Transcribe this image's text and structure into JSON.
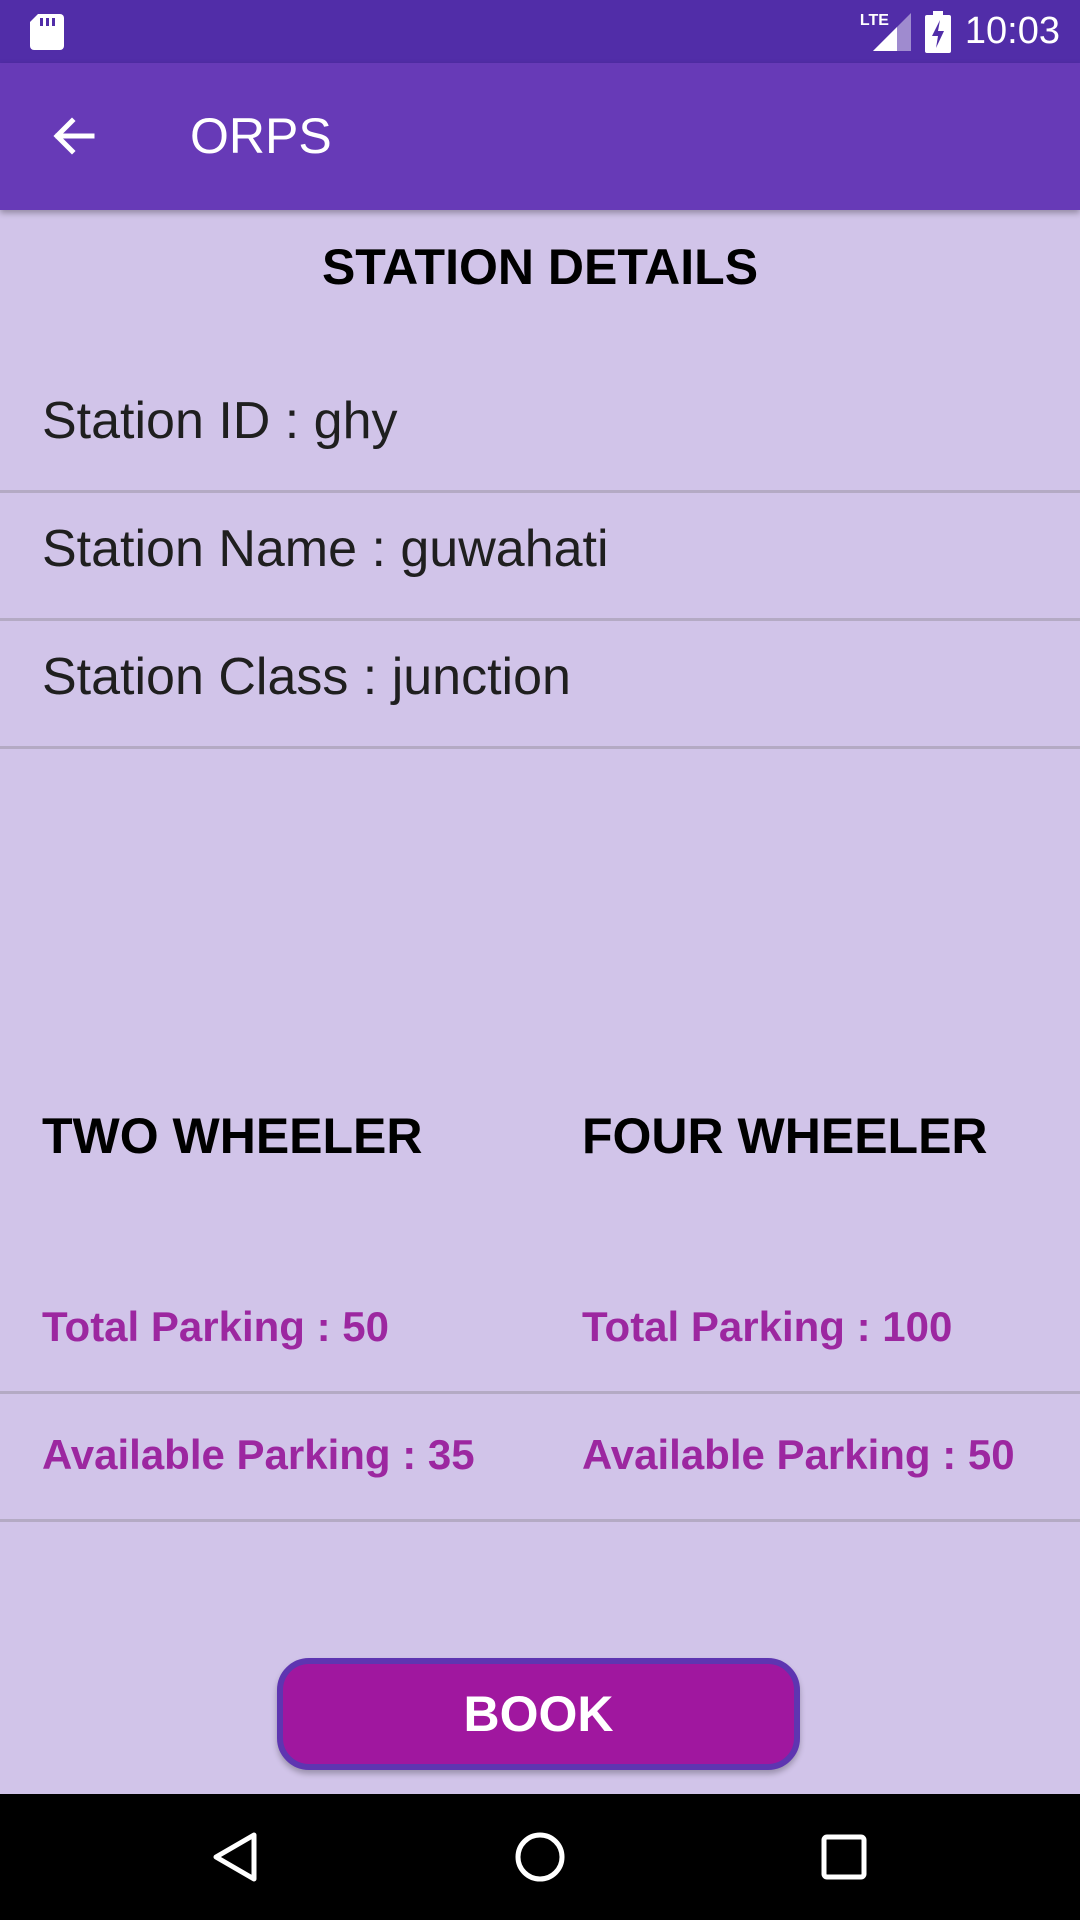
{
  "status_bar": {
    "network_label": "LTE",
    "time": "10:03",
    "icons": [
      "sd-card-icon",
      "signal-icon",
      "battery-charging-icon"
    ]
  },
  "app_bar": {
    "title": "ORPS",
    "back_icon": "back-arrow-icon"
  },
  "details": {
    "heading": "STATION DETAILS",
    "station_id": "Station ID : ghy",
    "station_name": "Station Name : guwahati",
    "station_class": "Station Class : junction"
  },
  "parking": {
    "two_wheeler": {
      "heading": "TWO WHEELER",
      "total": "Total Parking : 50",
      "available": "Available Parking : 35"
    },
    "four_wheeler": {
      "heading": "FOUR WHEELER",
      "total": "Total Parking : 100",
      "available": "Available Parking : 50"
    }
  },
  "actions": {
    "book_label": "BOOK"
  },
  "nav_bar": {
    "buttons": [
      "back-triangle-icon",
      "home-circle-icon",
      "recents-square-icon"
    ]
  },
  "colors": {
    "status_bar": "#512da8",
    "app_bar": "#673ab7",
    "background": "#d1c4e9",
    "accent_text": "#9c27a0",
    "button": "#a0179f"
  }
}
